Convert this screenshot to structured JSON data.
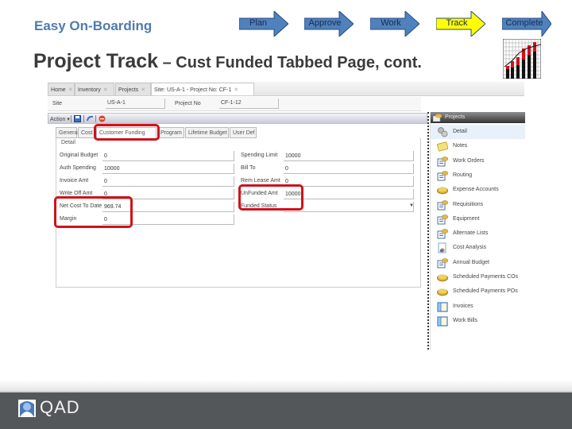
{
  "header": {
    "brand": "Easy On-Boarding",
    "steps": [
      {
        "label": "Plan",
        "state": "normal",
        "color": "#4f81bd"
      },
      {
        "label": "Approve",
        "state": "normal",
        "color": "#4f81bd"
      },
      {
        "label": "Work",
        "state": "normal",
        "color": "#4f81bd"
      },
      {
        "label": "Track",
        "state": "current",
        "color": "#ffff00"
      },
      {
        "label": "Complete",
        "state": "normal",
        "color": "#4f81bd"
      }
    ]
  },
  "title": {
    "main": "Project Track",
    "sub": " – Cust Funded Tabbed Page, cont."
  },
  "app": {
    "tabs": [
      {
        "label": "Home",
        "closable": true
      },
      {
        "label": "Inventory",
        "closable": true
      },
      {
        "label": "Projects",
        "closable": true
      },
      {
        "label": "Site: US-A-1 - Project No: CF-1",
        "closable": true,
        "active": true
      }
    ],
    "site_label": "Site",
    "site_value": "US-A-1",
    "project_label": "Project No",
    "project_value": "CF-1-12",
    "toolbar": {
      "action_label": "Action ▾"
    },
    "form_tabs": [
      {
        "label": "General"
      },
      {
        "label": "Cost"
      },
      {
        "label": "Customer Funding",
        "active": true,
        "highlighted": true
      },
      {
        "label": "Program"
      },
      {
        "label": "Lifetime Budget"
      },
      {
        "label": "User Def"
      }
    ],
    "panel_label": "Detail",
    "left_fields": [
      {
        "label": "Original Budget",
        "value": "0"
      },
      {
        "label": "Auth Spending",
        "value": "10000"
      },
      {
        "label": "Invoice Amt",
        "value": "0"
      },
      {
        "label": "Write Off Amt",
        "value": "0"
      },
      {
        "label": "Net Cost To Date",
        "value": "969.74",
        "highlighted": true
      },
      {
        "label": "Margin",
        "value": "0",
        "highlighted": true
      }
    ],
    "right_fields": [
      {
        "label": "Spending Limit",
        "value": "10000"
      },
      {
        "label": "Bill To",
        "value": "0"
      },
      {
        "label": "Rem Lease Amt",
        "value": "0"
      },
      {
        "label": "UnFunded Amt",
        "value": "10000",
        "highlighted": true
      },
      {
        "label": "Funded Status",
        "value": "",
        "dropdown": true,
        "highlighted": true
      }
    ],
    "side_panel": {
      "title": "Projects",
      "items": [
        {
          "label": "Detail",
          "icon": "gears-icon",
          "selected": true
        },
        {
          "label": "Notes",
          "icon": "notes-icon"
        },
        {
          "label": "Work Orders",
          "icon": "form-folder-icon"
        },
        {
          "label": "Routing",
          "icon": "form-folder-icon"
        },
        {
          "label": "Expense Accounts",
          "icon": "book-icon"
        },
        {
          "label": "Requisitions",
          "icon": "form-folder-icon"
        },
        {
          "label": "Equipment",
          "icon": "form-folder-icon"
        },
        {
          "label": "Alternate Lists",
          "icon": "form-folder-icon"
        },
        {
          "label": "Cost Analysis",
          "icon": "report-icon"
        },
        {
          "label": "Annual Budget",
          "icon": "form-folder-icon"
        },
        {
          "label": "Scheduled Payments COs",
          "icon": "book-icon"
        },
        {
          "label": "Scheduled Payments POs",
          "icon": "book-icon"
        },
        {
          "label": "Invoices",
          "icon": "window-icon"
        },
        {
          "label": "Work Bills",
          "icon": "window-icon"
        }
      ]
    }
  },
  "footer": {
    "logo_text": "QAD"
  }
}
